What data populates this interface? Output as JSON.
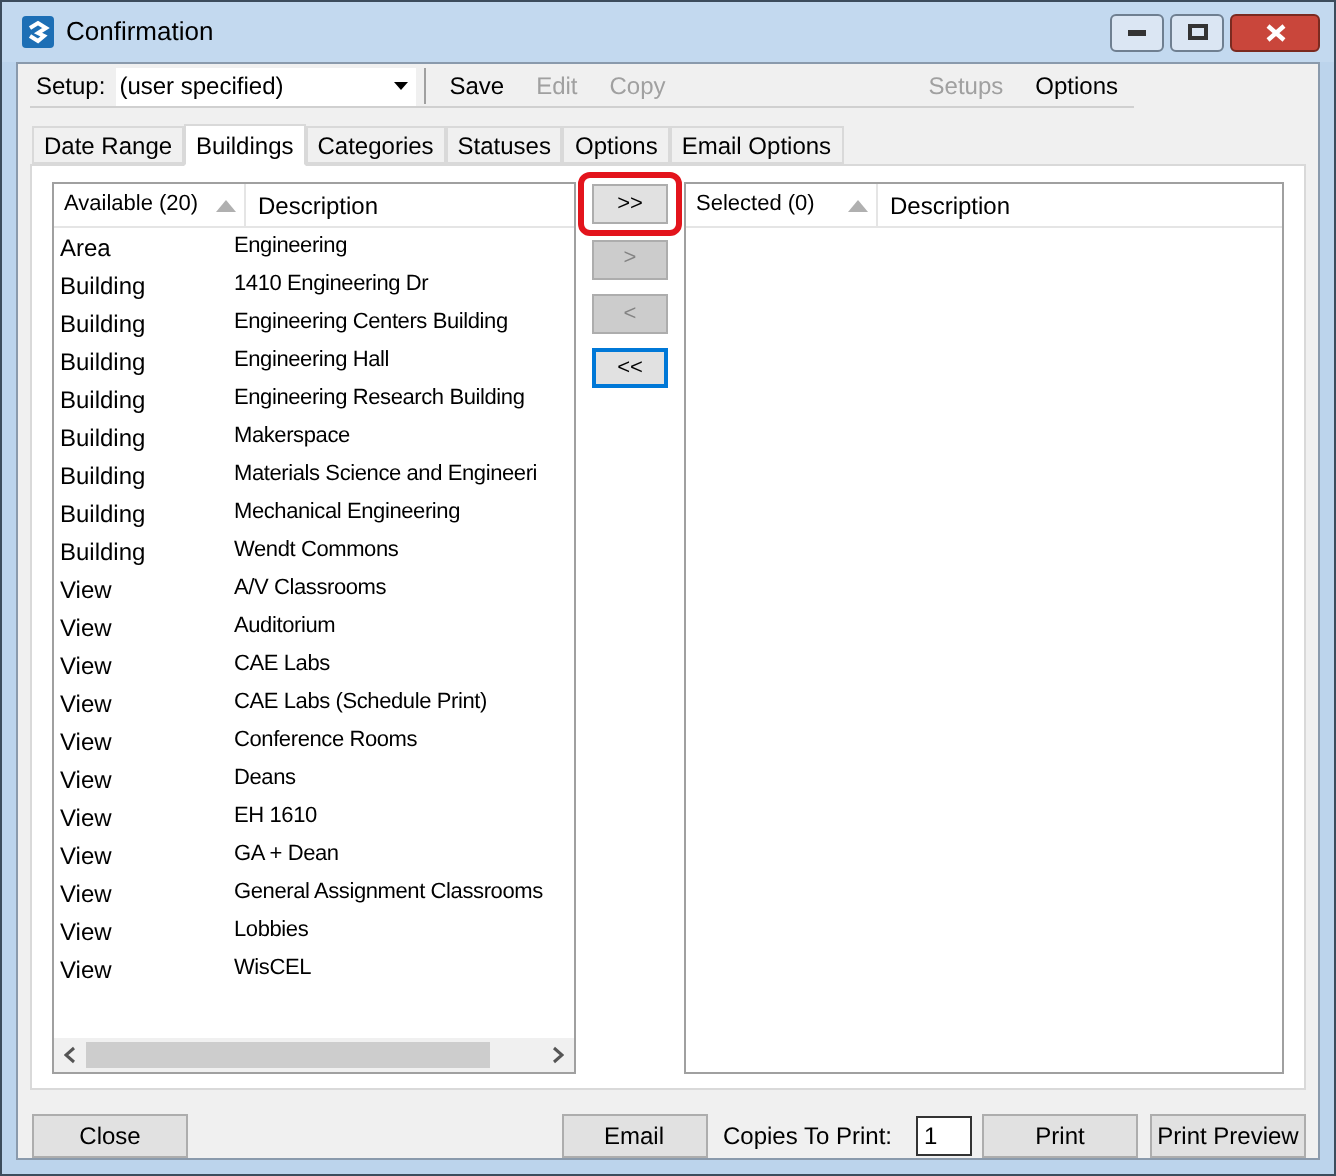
{
  "window": {
    "title": "Confirmation"
  },
  "toolbar": {
    "setup_label": "Setup:",
    "setup_value": "(user specified)",
    "actions": [
      {
        "label": "Save",
        "disabled": false
      },
      {
        "label": "Edit",
        "disabled": true
      },
      {
        "label": "Copy",
        "disabled": true
      }
    ],
    "right_actions": [
      {
        "label": "Setups",
        "disabled": true
      },
      {
        "label": "Options",
        "disabled": false
      }
    ]
  },
  "tabs": [
    {
      "label": "Date Range",
      "selected": false
    },
    {
      "label": "Buildings",
      "selected": true
    },
    {
      "label": "Categories",
      "selected": false
    },
    {
      "label": "Statuses",
      "selected": false
    },
    {
      "label": "Options",
      "selected": false
    },
    {
      "label": "Email Options",
      "selected": false
    }
  ],
  "available": {
    "columns": [
      "Available (20)",
      "Description"
    ],
    "rows": [
      {
        "type": "Area",
        "description": "Engineering"
      },
      {
        "type": "Building",
        "description": "1410 Engineering Dr"
      },
      {
        "type": "Building",
        "description": "Engineering Centers Building"
      },
      {
        "type": "Building",
        "description": "Engineering Hall"
      },
      {
        "type": "Building",
        "description": "Engineering Research Building"
      },
      {
        "type": "Building",
        "description": "Makerspace"
      },
      {
        "type": "Building",
        "description": "Materials Science and Engineeri"
      },
      {
        "type": "Building",
        "description": "Mechanical Engineering"
      },
      {
        "type": "Building",
        "description": "Wendt Commons"
      },
      {
        "type": "View",
        "description": "A/V Classrooms"
      },
      {
        "type": "View",
        "description": "Auditorium"
      },
      {
        "type": "View",
        "description": "CAE Labs"
      },
      {
        "type": "View",
        "description": "CAE Labs (Schedule Print)"
      },
      {
        "type": "View",
        "description": "Conference Rooms"
      },
      {
        "type": "View",
        "description": "Deans"
      },
      {
        "type": "View",
        "description": "EH 1610"
      },
      {
        "type": "View",
        "description": "GA + Dean"
      },
      {
        "type": "View",
        "description": "General Assignment Classrooms"
      },
      {
        "type": "View",
        "description": "Lobbies"
      },
      {
        "type": "View",
        "description": "WisCEL"
      }
    ]
  },
  "move_buttons": [
    {
      "label": ">>",
      "disabled": false,
      "focused": false,
      "highlighted": true
    },
    {
      "label": ">",
      "disabled": true,
      "focused": false,
      "highlighted": false
    },
    {
      "label": "<",
      "disabled": true,
      "focused": false,
      "highlighted": false
    },
    {
      "label": "<<",
      "disabled": false,
      "focused": true,
      "highlighted": false
    }
  ],
  "selected": {
    "columns": [
      "Selected (0)",
      "Description"
    ]
  },
  "footer": {
    "close": "Close",
    "email": "Email",
    "copies_label": "Copies To Print:",
    "copies_value": "1",
    "print": "Print",
    "print_preview": "Print Preview"
  }
}
